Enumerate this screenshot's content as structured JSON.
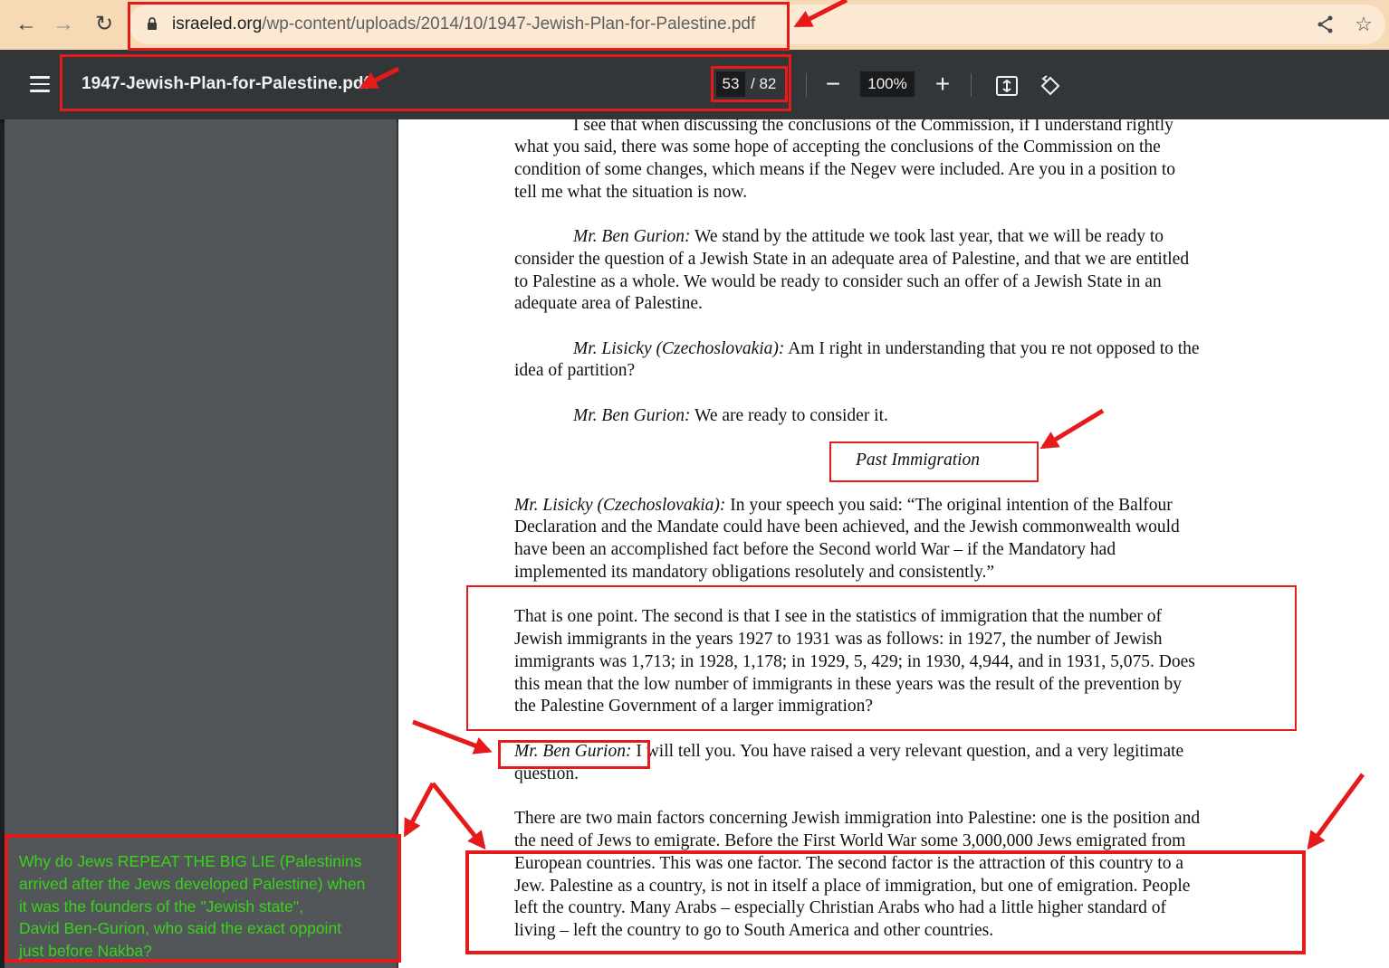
{
  "browser": {
    "url_host": "israeled.org",
    "url_path": "/wp-content/uploads/2014/10/1947-Jewish-Plan-for-Palestine.pdf",
    "icons": [
      "back-arrow-icon",
      "forward-arrow-icon",
      "reload-icon",
      "lock-icon",
      "share-icon",
      "star-icon"
    ]
  },
  "pdf_toolbar": {
    "filename": "1947-Jewish-Plan-for-Palestine.pdf",
    "current_page": "53",
    "total_pages": "/ 82",
    "zoom": "100%",
    "zoom_out": "−",
    "zoom_in": "+",
    "icons": [
      "menu-icon",
      "fit-page-icon",
      "rotate-icon"
    ]
  },
  "document": {
    "p1": [
      "I see that when discussing the conclusions of the Commission, if I understand rightly",
      "what you said, there was some hope of accepting the conclusions of the Commission on the",
      "condition of some changes, which means if the Negev were included.  Are you in a position to",
      "tell me what the situation is now."
    ],
    "p2": {
      "speaker": "Mr. Ben Gurion:",
      "lines": [
        " We stand by the attitude we took last year, that we will be ready to",
        "consider the question of a Jewish State in an adequate area of Palestine, and that we are entitled",
        "to Palestine as a whole.  We would be ready to consider such an offer of a Jewish State in an",
        "adequate area of Palestine."
      ]
    },
    "p3": {
      "speaker": "Mr. Lisicky (Czechoslovakia):",
      "lines": [
        " Am I right in understanding that you re not opposed to the",
        "idea of partition?"
      ]
    },
    "p4": {
      "speaker": "Mr. Ben Gurion:",
      "text": " We are ready to consider it."
    },
    "heading": "Past Immigration",
    "p5": {
      "speaker": "Mr. Lisicky (Czechoslovakia):",
      "lines": [
        " In your speech you said: “The original intention of the Balfour",
        "Declaration and the Mandate could have been achieved, and the Jewish commonwealth would",
        "have been an accomplished fact before the Second world War – if the Mandatory had",
        "implemented its mandatory obligations resolutely and consistently.”"
      ]
    },
    "p6": [
      "That is one point.  The second is that I see in the statistics of immigration that the number of",
      "Jewish immigrants in the years 1927 to 1931 was as follows: in 1927, the number of Jewish",
      "immigrants was 1,713; in 1928, 1,178; in 1929, 5, 429; in 1930, 4,944, and in 1931, 5,075.  Does",
      "this mean that the low number of immigrants in these years was the result of the prevention by",
      "the Palestine Government of a larger immigration?"
    ],
    "p7": {
      "speaker": "Mr. Ben Gurion:",
      "lines": [
        " I will tell you.  You have raised a very relevant question, and a very legitimate",
        "question."
      ]
    },
    "p8": [
      "There are two main factors concerning Jewish immigration into Palestine: one is the position and",
      "the need of Jews to emigrate.  Before the First World War some 3,000,000 Jews emigrated from",
      "European countries.  This was one factor.  The second factor is the attraction of this country to a",
      "Jew.  Palestine as a country, is not in itself a place of immigration, but one of emigration.  People",
      "left the country.  Many Arabs – especially Christian Arabs who had a little higher standard of",
      "living – left the country to go to South America and other countries."
    ]
  },
  "annotation_note": "Why do Jews REPEAT THE BIG LIE (Palestinins\narrived after the Jews developed Palestine) when\nit was the founders of the \"Jewish state\",\nDavid Ben-Gurion, who said the exact oppoint\njust before Nakba?",
  "colors": {
    "annotation_red": "#e51a1a",
    "note_green": "#3bd21c",
    "chrome_bg": "#f6d9b5",
    "toolbar_bg": "#323639",
    "sidebar_bg": "#525659"
  }
}
